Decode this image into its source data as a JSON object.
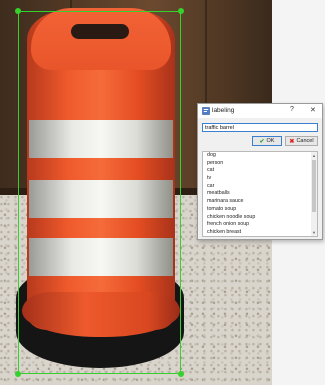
{
  "dialog": {
    "title": "labeling",
    "help_label": "?",
    "close_label": "✕",
    "input_value": "traffic barrel",
    "ok_label": "OK",
    "cancel_label": "Cancel",
    "items": [
      "dog",
      "person",
      "cat",
      "tv",
      "car",
      "meatballs",
      "marinara sauce",
      "tomato soup",
      "chicken noodle soup",
      "french onion soup",
      "chicken breast"
    ]
  },
  "colors": {
    "bbox": "#35d12c",
    "barrel_orange": "#f05a2c",
    "focus_blue": "#3b7fd1"
  },
  "icons": {
    "title_icon": "label-app-icon",
    "ok_icon": "check-icon",
    "cancel_icon": "x-icon"
  }
}
